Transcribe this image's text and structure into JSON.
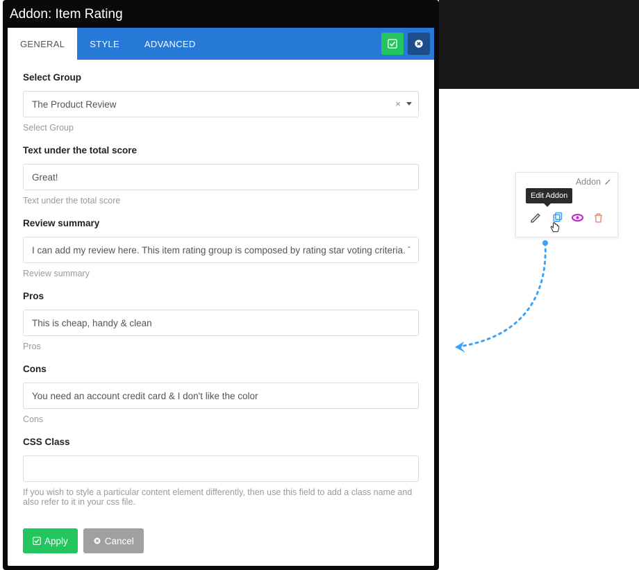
{
  "title": "Addon: Item Rating",
  "tabs": {
    "general": "GENERAL",
    "style": "STYLE",
    "advanced": "ADVANCED"
  },
  "fields": {
    "group": {
      "label": "Select Group",
      "value": "The Product Review",
      "help": "Select Group"
    },
    "score_text": {
      "label": "Text under the total score",
      "value": "Great!",
      "help": "Text under the total score"
    },
    "summary": {
      "label": "Review summary",
      "value": "I can add my review here. This item rating group is composed by rating star voting criteria. The glob",
      "help": "Review summary"
    },
    "pros": {
      "label": "Pros",
      "value": "This is cheap, handy & clean",
      "help": "Pros"
    },
    "cons": {
      "label": "Cons",
      "value": "You need an account credit card & I don't like the color",
      "help": "Cons"
    },
    "css": {
      "label": "CSS Class",
      "value": "",
      "help": "If you wish to style a particular content element differently, then use this field to add a class name and also refer to it in your css file."
    }
  },
  "buttons": {
    "apply": "Apply",
    "cancel": "Cancel"
  },
  "tooltip": {
    "tag": "Edit Addon",
    "label": "Addon"
  }
}
